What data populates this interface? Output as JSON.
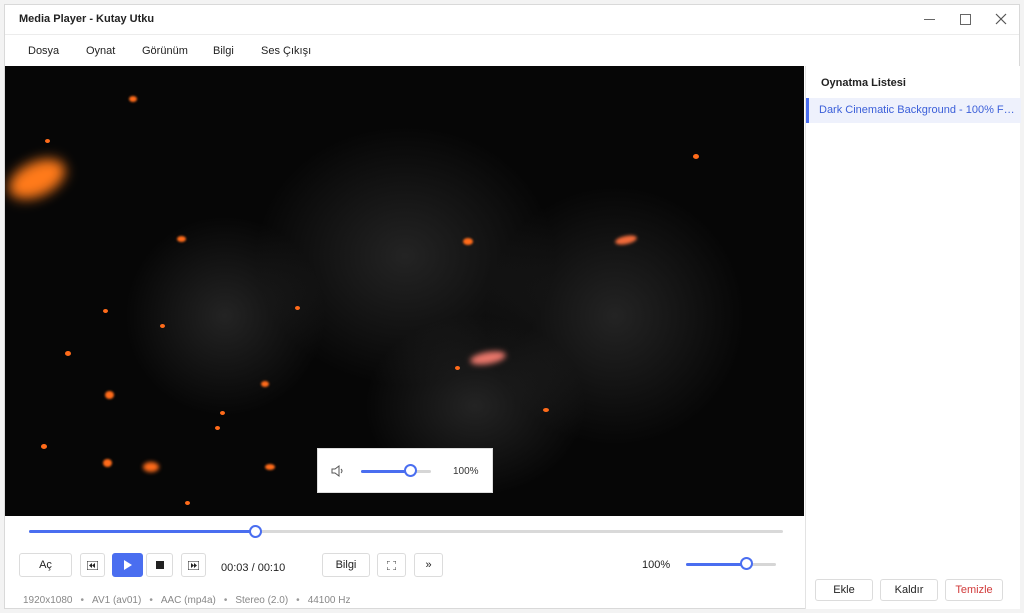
{
  "window": {
    "title": "Media Player - Kutay Utku"
  },
  "menu": [
    "Dosya",
    "Oynat",
    "Görünüm",
    "Bilgi",
    "Ses Çıkışı"
  ],
  "volume_popup": {
    "level": 0.7,
    "label": "100%"
  },
  "seek": {
    "progress": 0.3
  },
  "controls": {
    "open_label": "Aç",
    "time": "00:03 / 00:10",
    "info_label": "Bilgi",
    "more_label": "»",
    "volume_label": "100%",
    "volume_level": 0.67
  },
  "status": {
    "resolution": "1920x1080",
    "video_codec": "AV1 (av01)",
    "audio_codec": "AAC (mp4a)",
    "channels": "Stereo (2.0)",
    "sample_rate": "44100 Hz"
  },
  "playlist": {
    "title": "Oynatma Listesi",
    "items": [
      "Dark Cinematic Background - 100% Free..."
    ],
    "add_label": "Ekle",
    "remove_label": "Kaldır",
    "clear_label": "Temizle"
  },
  "colors": {
    "accent": "#4a6ef0",
    "danger": "#d13a3a",
    "video_bg": "#060606",
    "ember": "#ff6b1a"
  },
  "icons": [
    "minimize-icon",
    "maximize-icon",
    "close-icon",
    "speaker-icon",
    "previous-icon",
    "play-icon",
    "stop-icon",
    "next-icon",
    "fullscreen-icon"
  ]
}
